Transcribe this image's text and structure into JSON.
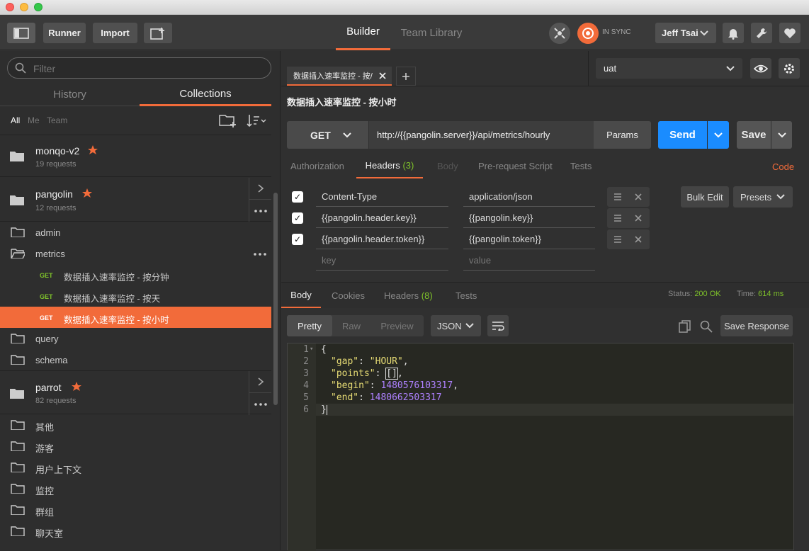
{
  "toolbar": {
    "runner": "Runner",
    "import": "Import",
    "builder": "Builder",
    "team_library": "Team Library",
    "sync_status": "IN SYNC",
    "user": "Jeff Tsai"
  },
  "sidebar": {
    "filter_placeholder": "Filter",
    "tabs": {
      "history": "History",
      "collections": "Collections"
    },
    "scope": {
      "all": "All",
      "me": "Me",
      "team": "Team"
    },
    "collections": [
      {
        "name": "monqo-v2",
        "count": "19 requests"
      },
      {
        "name": "pangolin",
        "count": "12 requests"
      },
      {
        "name": "parrot",
        "count": "82 requests"
      }
    ],
    "pangolin_folders": {
      "admin": "admin",
      "metrics": "metrics",
      "query": "query",
      "schema": "schema"
    },
    "requests": [
      {
        "method": "GET",
        "name": "数据插入速率监控 - 按分钟"
      },
      {
        "method": "GET",
        "name": "数据插入速率监控 - 按天"
      },
      {
        "method": "GET",
        "name": "数据插入速率监控 - 按小时"
      }
    ],
    "folders": [
      "其他",
      "游客",
      "用户上下文",
      "监控",
      "群组",
      "聊天室"
    ]
  },
  "environment": {
    "selected": "uat"
  },
  "request": {
    "tab_label": "数据插入速率监控 - 按/",
    "title": "数据插入速率监控 - 按小时",
    "method": "GET",
    "url": "http://{{pangolin.server}}/api/metrics/hourly",
    "params": "Params",
    "send": "Send",
    "save": "Save",
    "subtabs": {
      "authorization": "Authorization",
      "headers": "Headers",
      "headers_count": "(3)",
      "body": "Body",
      "prerequest": "Pre-request Script",
      "tests": "Tests",
      "code": "Code"
    },
    "headers": [
      {
        "key": "Content-Type",
        "value": "application/json"
      },
      {
        "key": "{{pangolin.header.key}}",
        "value": "{{pangolin.key}}"
      },
      {
        "key": "{{pangolin.header.token}}",
        "value": "{{pangolin.token}}"
      }
    ],
    "key_placeholder": "key",
    "value_placeholder": "value",
    "bulk_edit": "Bulk Edit",
    "presets": "Presets"
  },
  "response": {
    "tabs": {
      "body": "Body",
      "cookies": "Cookies",
      "headers": "Headers",
      "headers_count": "(8)",
      "tests": "Tests"
    },
    "status_label": "Status:",
    "status_value": "200 OK",
    "time_label": "Time:",
    "time_value": "614 ms",
    "view_modes": {
      "pretty": "Pretty",
      "raw": "Raw",
      "preview": "Preview"
    },
    "format": "JSON",
    "save_response": "Save Response",
    "line_numbers": [
      "1",
      "2",
      "3",
      "4",
      "5",
      "6"
    ],
    "json": {
      "open": "{",
      "gap_key": "\"gap\"",
      "gap_value": "\"HOUR\"",
      "points_key": "\"points\"",
      "points_value": "[]",
      "begin_key": "\"begin\"",
      "begin_value": "1480576103317",
      "end_key": "\"end\"",
      "end_value": "1480662503317",
      "close": "}"
    }
  },
  "colors": {
    "accent": "#f26b3a",
    "send": "#1a8cff",
    "get": "#7ec12a",
    "status_ok": "#7ec12a"
  }
}
